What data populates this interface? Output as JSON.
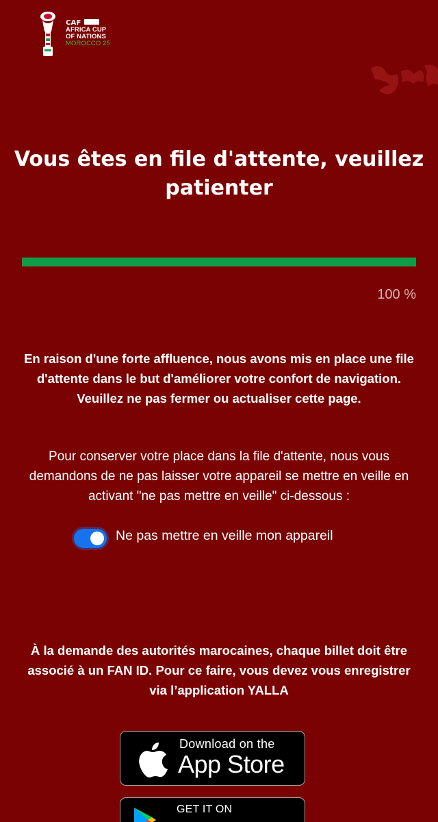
{
  "logo": {
    "caf": "CAF",
    "line1": "AFRICA CUP",
    "line2": "OF NATIONS",
    "line3": "MOROCCO 25"
  },
  "title": "Vous êtes en file d'attente, veuillez patienter",
  "progress": {
    "value": 100,
    "label": "100 %",
    "fill_color": "#0f9d48"
  },
  "notice_bold": "En raison d'une forte affluence, nous avons mis en place une file d'attente dans le but d'améliorer votre confort de navigation. Veuillez ne pas fermer ou actualiser cette page.",
  "notice": "Pour conserver votre place dans la file d'attente, nous vous demandons de ne pas laisser votre appareil se mettre en veille en activant \"ne pas mettre en veille\" ci-dessous :",
  "sleep_toggle": {
    "checked": true,
    "label": "Ne pas mettre en veille mon appareil",
    "color": "#1673f0"
  },
  "yalla_notice": "À la demande des autorités marocaines, chaque billet doit être associé à un FAN ID. Pour ce faire, vous devez vous enregistrer via l’application YALLA",
  "app_store": {
    "small": "Download on the",
    "big": "App Store"
  },
  "google_play": {
    "small": "GET IT ON"
  },
  "colors": {
    "background": "#7b0202",
    "accent": "#0f9d48"
  }
}
